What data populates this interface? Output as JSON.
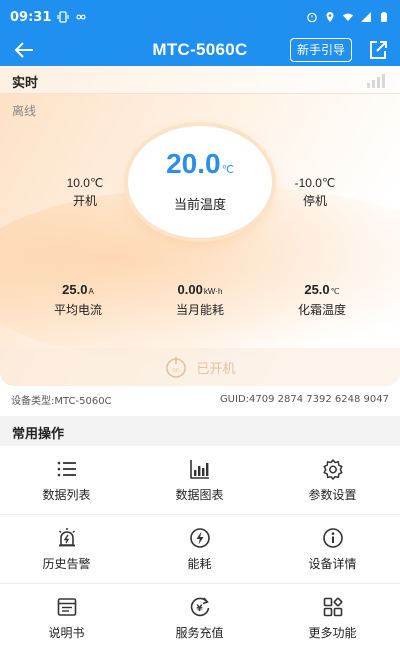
{
  "status_bar": {
    "time": "09:31"
  },
  "header": {
    "title": "MTC-5060C",
    "guide_label": "新手引导"
  },
  "realtime": {
    "section_label": "实时",
    "connection_status": "离线",
    "current_temp": {
      "value": "20.0",
      "unit": "℃",
      "label": "当前温度"
    },
    "on_temp": {
      "value": "10.0℃",
      "label": "开机"
    },
    "off_temp": {
      "value": "-10.0℃",
      "label": "停机"
    },
    "metrics": [
      {
        "value": "25.0",
        "unit": "A",
        "label": "平均电流"
      },
      {
        "value": "0.00",
        "unit": "kW·h",
        "label": "当月能耗"
      },
      {
        "value": "25.0",
        "unit": "℃",
        "label": "化霜温度"
      }
    ],
    "power_label": "已开机"
  },
  "device": {
    "type_text": "设备类型:MTC-5060C",
    "guid_text": "GUID:4709 2874 7392 6248 9047"
  },
  "operations": {
    "title": "常用操作",
    "items": [
      {
        "label": "数据列表",
        "icon": "list-icon"
      },
      {
        "label": "数据图表",
        "icon": "bar-chart-icon"
      },
      {
        "label": "参数设置",
        "icon": "gear-icon"
      },
      {
        "label": "历史告警",
        "icon": "alarm-icon"
      },
      {
        "label": "能耗",
        "icon": "lightning-icon"
      },
      {
        "label": "设备详情",
        "icon": "info-icon"
      },
      {
        "label": "说明书",
        "icon": "manual-icon"
      },
      {
        "label": "服务充值",
        "icon": "recharge-icon"
      },
      {
        "label": "更多功能",
        "icon": "more-icon"
      }
    ]
  },
  "colors": {
    "primary": "#1f8ff0",
    "temp_value": "#2b8ee8",
    "power_inactive": "#e0c3a3"
  }
}
